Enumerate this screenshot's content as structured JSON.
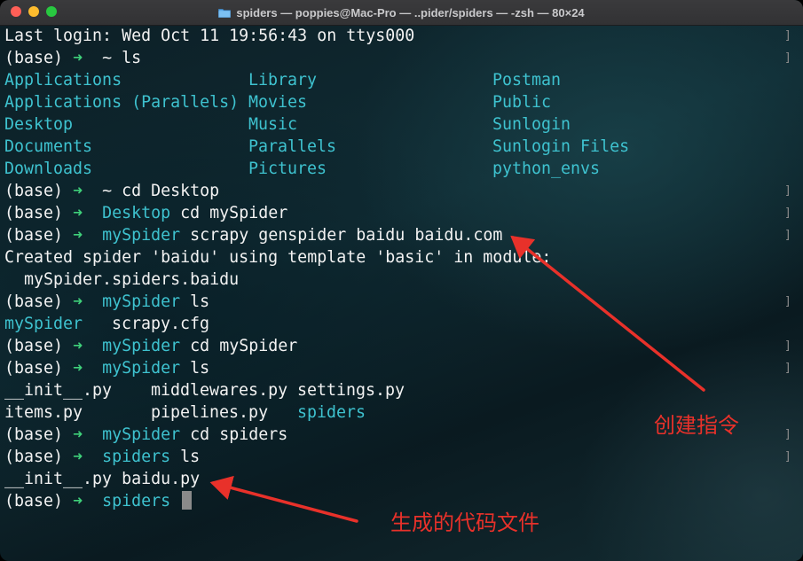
{
  "window": {
    "title": "spiders — poppies@Mac-Pro — ..pider/spiders — -zsh — 80×24"
  },
  "icons": {
    "close": "close-traffic-light",
    "minimize": "minimize-traffic-light",
    "maximize": "maximize-traffic-light",
    "title": "folder-icon"
  },
  "colors": {
    "directory": "#3ec2cf",
    "prompt_arrow": "#3fd17a",
    "annotation": "#e8312a"
  },
  "terminal": {
    "prompt_env": "(base)",
    "prompt_arrow": "➜",
    "last_login": "Last login: Wed Oct 11 19:56:43 on ttys000",
    "p1": {
      "dir": "~",
      "cmd": "ls"
    },
    "home_listing": {
      "col1": [
        "Applications",
        "Applications (Parallels)",
        "Desktop",
        "Documents",
        "Downloads"
      ],
      "col2": [
        "Library",
        "Movies",
        "Music",
        "Parallels",
        "Pictures"
      ],
      "col3": [
        "Postman",
        "Public",
        "Sunlogin",
        "Sunlogin Files",
        "python_envs"
      ]
    },
    "p2": {
      "dir": "~",
      "cmd": "cd Desktop"
    },
    "p3": {
      "dir": "Desktop",
      "cmd": "cd mySpider"
    },
    "p4": {
      "dir": "mySpider",
      "cmd": "scrapy genspider baidu baidu.com"
    },
    "created_line1": "Created spider 'baidu' using template 'basic' in module:",
    "created_line2": "  mySpider.spiders.baidu",
    "p5": {
      "dir": "mySpider",
      "cmd": "ls"
    },
    "listing_a": {
      "dir": "mySpider",
      "file": "scrapy.cfg"
    },
    "p6": {
      "dir": "mySpider",
      "cmd": "cd mySpider"
    },
    "p7": {
      "dir": "mySpider",
      "cmd": "ls"
    },
    "listing_b": {
      "row1": [
        "__init__.py",
        "middlewares.py",
        "settings.py"
      ],
      "row2": [
        "items.py",
        "pipelines.py",
        "spiders"
      ]
    },
    "p8": {
      "dir": "mySpider",
      "cmd": "cd spiders"
    },
    "p9": {
      "dir": "spiders",
      "cmd": "ls"
    },
    "listing_c": "__init__.py baidu.py",
    "p10": {
      "dir": "spiders",
      "cmd": ""
    }
  },
  "annotations": {
    "create_command": "创建指令",
    "generated_file": "生成的代码文件"
  }
}
